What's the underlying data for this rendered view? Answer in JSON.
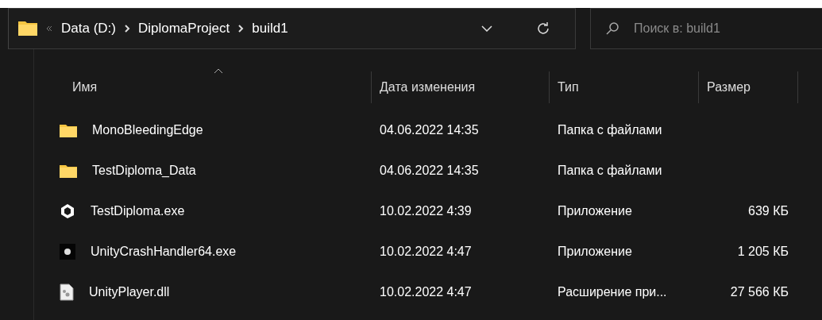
{
  "address_bar": {
    "crumbs": [
      "Data (D:)",
      "DiplomaProject",
      "build1"
    ]
  },
  "search": {
    "placeholder": "Поиск в: build1"
  },
  "columns": [
    {
      "label": "Имя",
      "sorted": true
    },
    {
      "label": "Дата изменения",
      "sorted": false
    },
    {
      "label": "Тип",
      "sorted": false
    },
    {
      "label": "Размер",
      "sorted": false
    }
  ],
  "rows": [
    {
      "kind": "folder",
      "name": "MonoBleedingEdge",
      "date": "04.06.2022 14:35",
      "type": "Папка с файлами"
    },
    {
      "kind": "folder",
      "name": "TestDiploma_Data",
      "date": "04.06.2022 14:35",
      "type": "Папка с файлами"
    },
    {
      "kind": "unity",
      "name": "TestDiploma.exe",
      "date": "10.02.2022 4:39",
      "type": "Приложение",
      "size": "639 КБ"
    },
    {
      "kind": "crash",
      "name": "UnityCrashHandler64.exe",
      "date": "10.02.2022 4:47",
      "type": "Приложение",
      "size": "1 205 КБ"
    },
    {
      "kind": "dll",
      "name": "UnityPlayer.dll",
      "date": "10.02.2022 4:47",
      "type": "Расширение при...",
      "size": "27 566 КБ"
    }
  ]
}
